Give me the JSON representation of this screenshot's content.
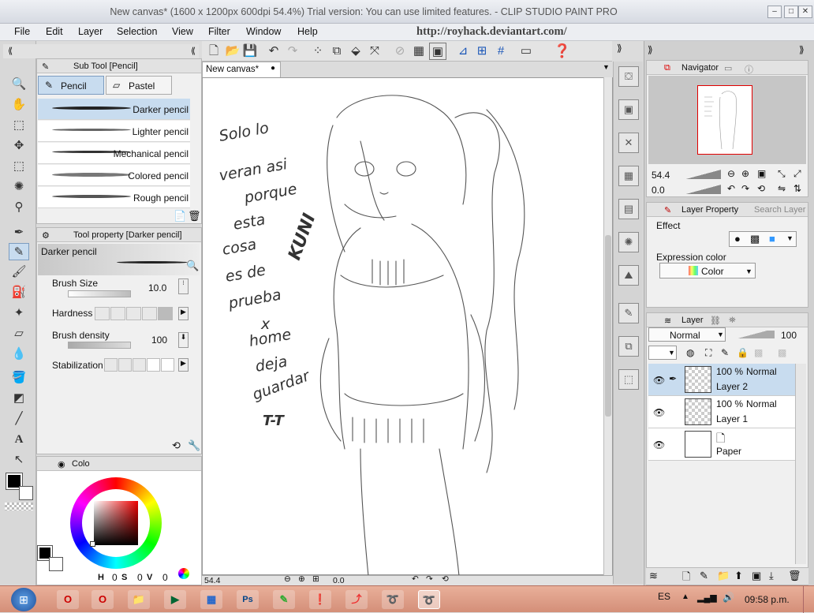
{
  "window": {
    "title": "New canvas* (1600 x 1200px 600dpi 54.4%)  Trial version: You can use limited features. - CLIP STUDIO PAINT PRO",
    "minimize": "–",
    "maximize": "□",
    "close": "✕"
  },
  "menu": [
    "File",
    "Edit",
    "Layer",
    "Selection",
    "View",
    "Filter",
    "Window",
    "Help"
  ],
  "watermark": "http://royhack.deviantart.com/",
  "subtool": {
    "header": "Sub Tool [Pencil]",
    "tabs": [
      "Pencil",
      "Pastel"
    ],
    "brushes": [
      "Darker pencil",
      "Lighter pencil",
      "Mechanical pencil",
      "Colored pencil",
      "Rough pencil"
    ]
  },
  "toolprop": {
    "header": "Tool property [Darker pencil]",
    "preview_label": "Darker pencil",
    "brush_size_label": "Brush Size",
    "brush_size": "10.0",
    "hardness_label": "Hardness",
    "density_label": "Brush density",
    "density": "100",
    "stabilization_label": "Stabilization"
  },
  "color_panel": {
    "tab_label": "Colo",
    "h": "0",
    "s": "0",
    "v": "0",
    "h_label": "H",
    "s_label": "S",
    "v_label": "V"
  },
  "canvas": {
    "tab": "New canvas*",
    "zoom": "54.4",
    "rotation": "0.0",
    "handwriting": [
      "Solo lo",
      "veran asi",
      "porque",
      "esta",
      "cosa",
      "es de",
      "prueba",
      "x",
      "home",
      "deja",
      "guardar"
    ],
    "sign": "KUNI",
    "face": "T-T"
  },
  "navigator": {
    "tab": "Navigator",
    "zoom": "54.4",
    "rotation": "0.0"
  },
  "layer_property": {
    "tab": "Layer Property",
    "tab2": "Search Layer",
    "effect_label": "Effect",
    "expression_label": "Expression color",
    "expression_value": "Color"
  },
  "layers": {
    "tab": "Layer",
    "blend": "Normal",
    "opacity": "100",
    "items": [
      {
        "opacity": "100 %",
        "mode": "Normal",
        "name": "Layer 2"
      },
      {
        "opacity": "100 %",
        "mode": "Normal",
        "name": "Layer 1"
      },
      {
        "opacity": "",
        "mode": "",
        "name": "Paper"
      }
    ]
  },
  "taskbar": {
    "lang": "ES",
    "time": "09:58 p.m."
  },
  "colors": {
    "accent_selected": "#c8dcef",
    "taskbar": "#d48f78",
    "nav_frame": "#e00000"
  }
}
